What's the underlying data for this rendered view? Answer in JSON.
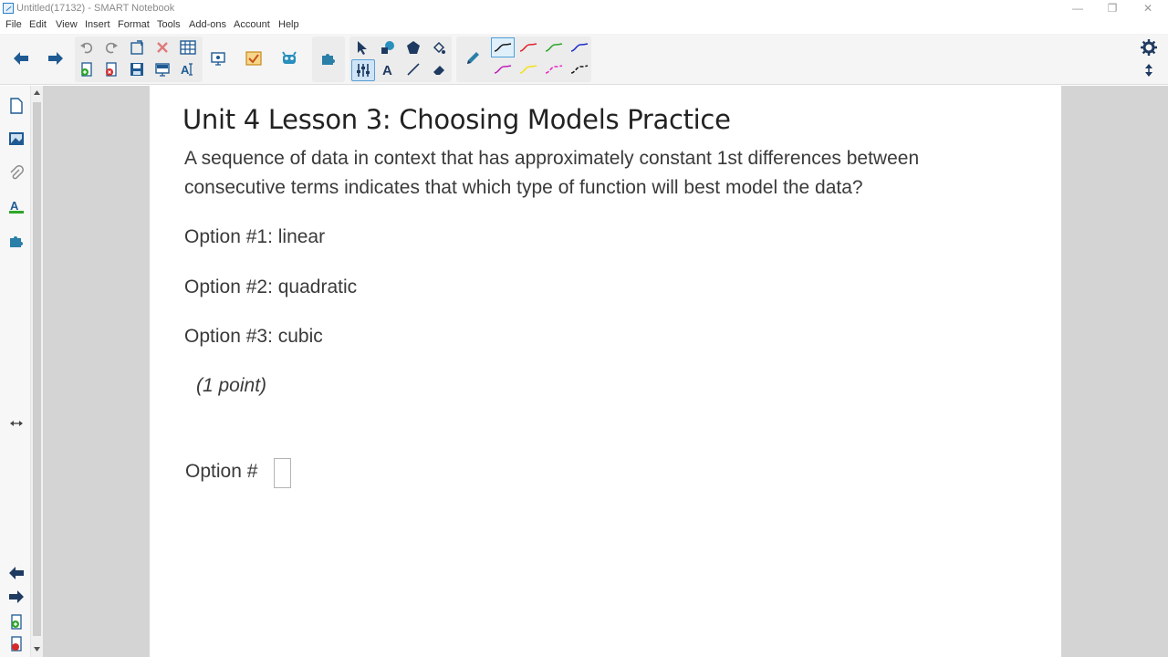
{
  "window": {
    "title": "Untitled(17132) - SMART Notebook",
    "controls": [
      "—",
      "❐",
      "✕"
    ]
  },
  "menu": [
    "File",
    "Edit",
    "View",
    "Insert",
    "Format",
    "Tools",
    "Add-ons",
    "Account",
    "Help"
  ],
  "toolbar": {
    "pen_colors": {
      "black": "#1a1a1a",
      "red": "#e0252b",
      "green": "#2fa62a",
      "blue": "#1c2fc9",
      "magenta": "#c020b8",
      "yellow": "#f2e21a",
      "pink": "#e62cc4",
      "dashed_black": "#1a1a1a"
    },
    "accent": "#2a7fc9"
  },
  "page": {
    "title": "Unit 4 Lesson 3: Choosing Models Practice",
    "question_line1": "A sequence of data in context that has approximately constant 1st differences between",
    "question_line2": "consecutive terms indicates that which type of function will best model the data?",
    "option1": "Option #1: linear",
    "option2": "Option #2: quadratic",
    "option3": "Option #3: cubic",
    "points": "(1 point)",
    "answer_label": "Option #",
    "answer_value": ""
  }
}
